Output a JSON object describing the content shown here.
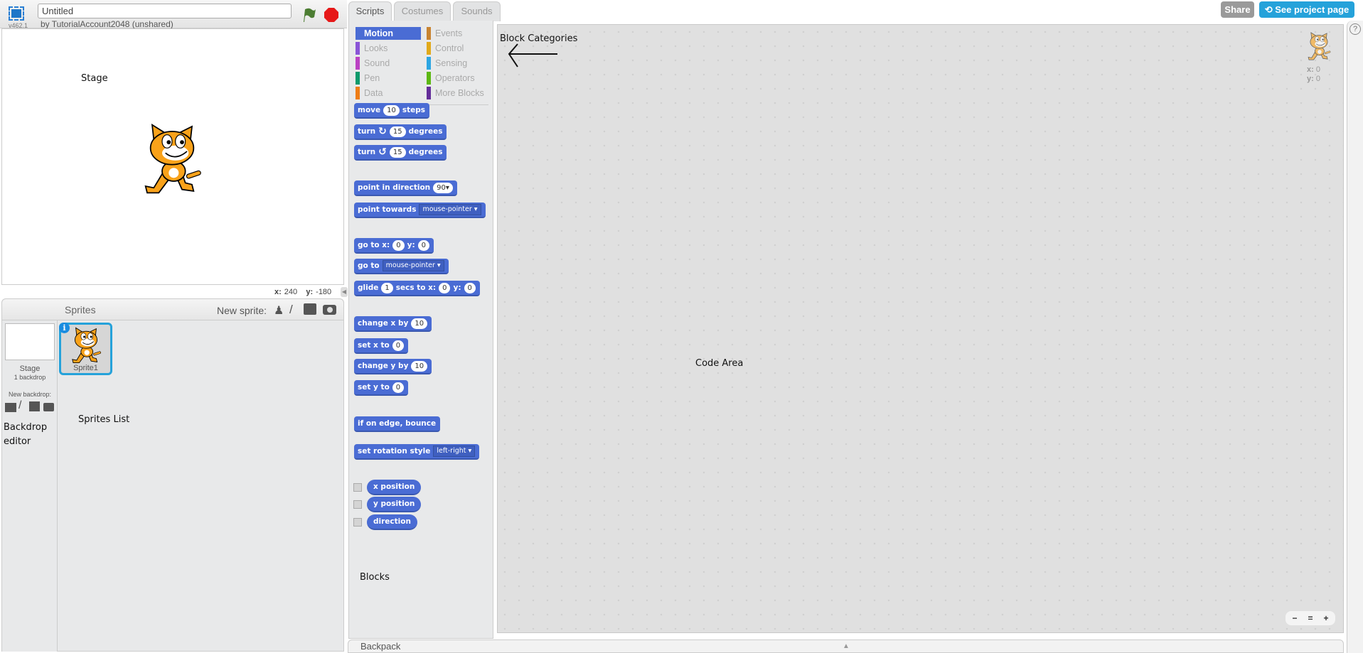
{
  "header": {
    "version": "v462.1",
    "project_title": "Untitled",
    "author": "by TutorialAccount2048 (unshared)",
    "icons": [
      "fullscreen-icon",
      "green-flag-icon",
      "stop-icon"
    ]
  },
  "stage": {
    "coords": {
      "x_label": "x:",
      "x": "240",
      "y_label": "y:",
      "y": "-180"
    }
  },
  "sprites": {
    "title": "Sprites",
    "new_sprite_label": "New sprite:",
    "stage_label": "Stage",
    "backdrop_count": "1 backdrop",
    "new_backdrop_label": "New backdrop:",
    "items": [
      {
        "name": "Sprite1"
      }
    ]
  },
  "tabs": [
    {
      "label": "Scripts"
    },
    {
      "label": "Costumes"
    },
    {
      "label": "Sounds"
    }
  ],
  "categories": [
    {
      "label": "Motion",
      "color": "#4a6cd4",
      "selected": true
    },
    {
      "label": "Looks",
      "color": "#8a55d7"
    },
    {
      "label": "Sound",
      "color": "#bb42c3"
    },
    {
      "label": "Pen",
      "color": "#0e9a6c"
    },
    {
      "label": "Data",
      "color": "#ee7d16"
    },
    {
      "label": "Events",
      "color": "#c88330"
    },
    {
      "label": "Control",
      "color": "#e1a91a"
    },
    {
      "label": "Sensing",
      "color": "#2ca5e2"
    },
    {
      "label": "Operators",
      "color": "#5cb712"
    },
    {
      "label": "More Blocks",
      "color": "#632d99"
    }
  ],
  "blocks": [
    {
      "parts": [
        {
          "t": "move"
        },
        {
          "in": "10"
        },
        {
          "t": "steps"
        }
      ]
    },
    {
      "parts": [
        {
          "t": "turn"
        },
        {
          "icon": "↻"
        },
        {
          "in": "15"
        },
        {
          "t": "degrees"
        }
      ]
    },
    {
      "parts": [
        {
          "t": "turn"
        },
        {
          "icon": "↺"
        },
        {
          "in": "15"
        },
        {
          "t": "degrees"
        }
      ]
    },
    {
      "parts": [
        {
          "t": "point in direction"
        },
        {
          "in": "90▾"
        }
      ]
    },
    {
      "parts": [
        {
          "t": "point towards"
        },
        {
          "dd": "mouse-pointer ▾"
        }
      ]
    },
    {
      "parts": [
        {
          "t": "go to x:"
        },
        {
          "in": "0"
        },
        {
          "t": "y:"
        },
        {
          "in": "0"
        }
      ]
    },
    {
      "parts": [
        {
          "t": "go to"
        },
        {
          "dd": "mouse-pointer ▾"
        }
      ]
    },
    {
      "parts": [
        {
          "t": "glide"
        },
        {
          "in": "1"
        },
        {
          "t": "secs to x:"
        },
        {
          "in": "0"
        },
        {
          "t": "y:"
        },
        {
          "in": "0"
        }
      ]
    },
    {
      "parts": [
        {
          "t": "change x by"
        },
        {
          "in": "10"
        }
      ]
    },
    {
      "parts": [
        {
          "t": "set x to"
        },
        {
          "in": "0"
        }
      ]
    },
    {
      "parts": [
        {
          "t": "change y by"
        },
        {
          "in": "10"
        }
      ]
    },
    {
      "parts": [
        {
          "t": "set y to"
        },
        {
          "in": "0"
        }
      ]
    },
    {
      "parts": [
        {
          "t": "if on edge, bounce"
        }
      ]
    },
    {
      "parts": [
        {
          "t": "set rotation style"
        },
        {
          "dd": "left-right ▾"
        }
      ]
    },
    {
      "reporter": true,
      "parts": [
        {
          "t": "x position"
        }
      ]
    },
    {
      "reporter": true,
      "parts": [
        {
          "t": "y position"
        }
      ]
    },
    {
      "reporter": true,
      "parts": [
        {
          "t": "direction"
        }
      ]
    }
  ],
  "toolbar": {
    "share": "Share",
    "see_project_page": "See project page"
  },
  "code_area": {
    "sprite_x_label": "x:",
    "sprite_x": "0",
    "sprite_y_label": "y:",
    "sprite_y": "0",
    "zoom_out": "−",
    "zoom_reset": "=",
    "zoom_in": "+"
  },
  "backpack": {
    "label": "Backpack"
  },
  "help": {
    "icon": "?"
  },
  "annotations": {
    "stage": "Stage",
    "block_categories": "Block Categories",
    "code_area": "Code Area",
    "sprites_list": "Sprites List",
    "backdrop_editor": "Backdrop editor",
    "blocks": "Blocks"
  },
  "colors": {
    "motion": "#4a6cd4",
    "share": "#9a9a9a",
    "project_page": "#25a2da"
  }
}
